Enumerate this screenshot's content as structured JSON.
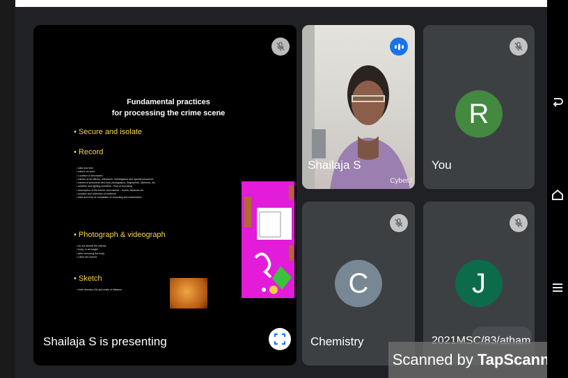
{
  "presentation": {
    "presenter_label": "Shailaja S is presenting",
    "slide": {
      "title_line1": "Fundamental practices",
      "title_line2": "for processing the crime scene",
      "sections": [
        {
          "heading": "• Secure and isolate",
          "items": []
        },
        {
          "heading": "• Record",
          "items": [
            "• date and time",
            "• nature of crime",
            "• Location & description",
            "• names of all officers, witnesses, investigators and special personnel",
            "• names of personnel who took photographs, fingerprints, sketches, etc",
            "• weather and lighting condition - time of recording",
            "• description of the interior and exterior - rooms, windows etc",
            "• location and collection of evidence",
            "• date and time of completion of recording and examination"
          ]
        },
        {
          "heading": "• Photograph & videograph",
          "items": [
            "• do not disturb the objects",
            "• body- in all angles",
            "• after removing the body",
            "• rulers are placed"
          ]
        },
        {
          "heading": "• Sketch",
          "items": [
            "• Note direction (N) and scale of distance"
          ]
        }
      ]
    }
  },
  "participants": [
    {
      "name": "Shailaja S",
      "watermark": "CyberJ",
      "speaking": true
    },
    {
      "name": "You",
      "initial": "R",
      "avatar_color": "#43893f",
      "muted": true
    },
    {
      "name": "Chemistry",
      "initial": "C",
      "avatar_color": "#778894",
      "muted": true
    },
    {
      "name": "2021MSC/83/atham",
      "initial": "J",
      "avatar_color": "#0c6b4a",
      "muted": true
    }
  ],
  "scanner_banner": {
    "prefix": "Scanned by ",
    "brand": "TapScanner"
  },
  "icons": [
    "mic-off-icon",
    "speaking-indicator-icon",
    "fullscreen-icon",
    "back-nav-icon",
    "home-nav-icon",
    "menu-nav-icon"
  ],
  "colors": {
    "background": "#202124",
    "tile": "#3c4043",
    "speaking_blue": "#1a73e8"
  }
}
